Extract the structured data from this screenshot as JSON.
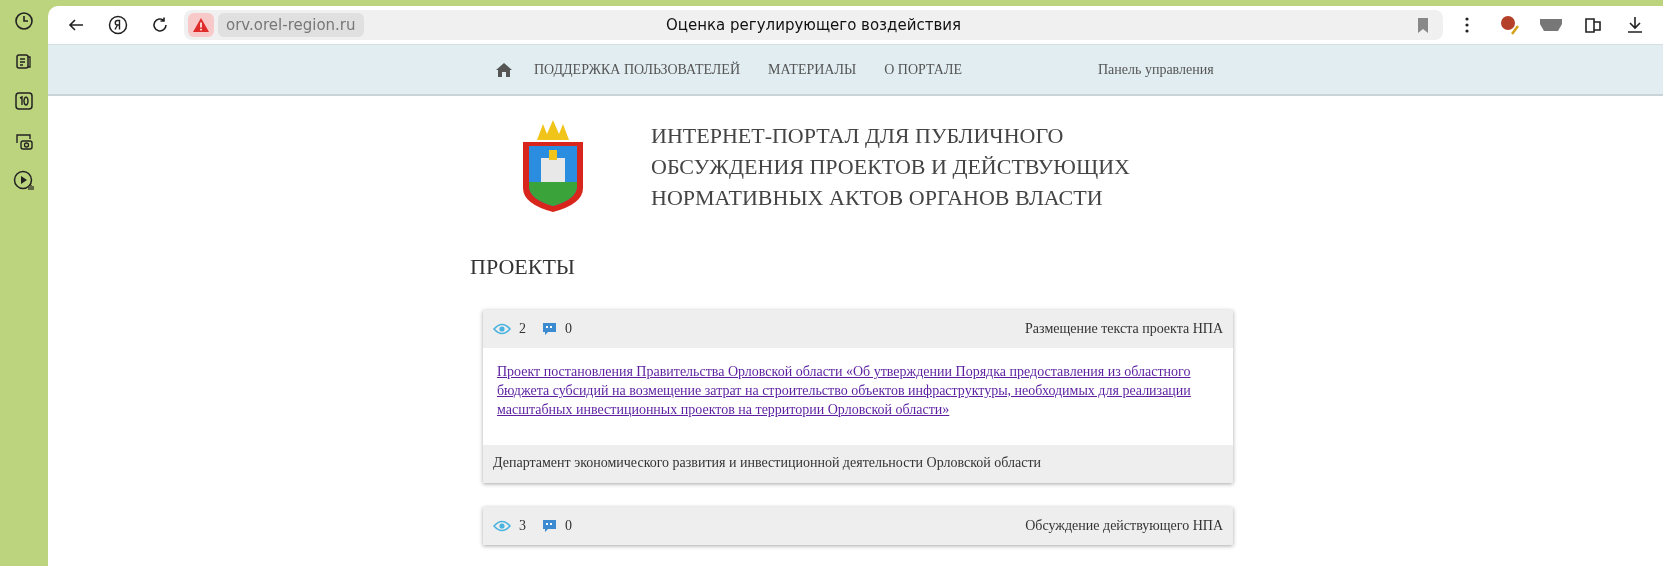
{
  "browser": {
    "address": "orv.orel-region.ru",
    "title": "Оценка регулирующего воздействия"
  },
  "nav": {
    "items": [
      {
        "label": "ПОДДЕРЖКА ПОЛЬЗОВАТЕЛЕЙ"
      },
      {
        "label": "МАТЕРИАЛЫ"
      },
      {
        "label": "О ПОРТАЛЕ"
      }
    ],
    "panel": "Панель управления"
  },
  "header": {
    "title_lines": [
      "ИНТЕРНЕТ-ПОРТАЛ ДЛЯ ПУБЛИЧНОГО",
      "ОБСУЖДЕНИЯ ПРОЕКТОВ И ДЕЙСТВУЮЩИХ",
      "НОРМАТИВНЫХ АКТОВ ОРГАНОВ ВЛАСТИ"
    ]
  },
  "section_title": "ПРОЕКТЫ",
  "projects": [
    {
      "views": "2",
      "comments": "0",
      "stage": "Размещение текста проекта НПА",
      "title": "Проект постановления Правительства Орловской области «Об утверждении Порядка предоставления из областного бюджета субсидий на возмещение затрат на строительство объектов инфраструктуры, необходимых для реализации масштабных инвестиционных проектов на территории Орловской области»",
      "department": "Департамент экономического развития и инвестиционной деятельности Орловской области"
    },
    {
      "views": "3",
      "comments": "0",
      "stage": "Обсуждение действующего НПА"
    }
  ]
}
